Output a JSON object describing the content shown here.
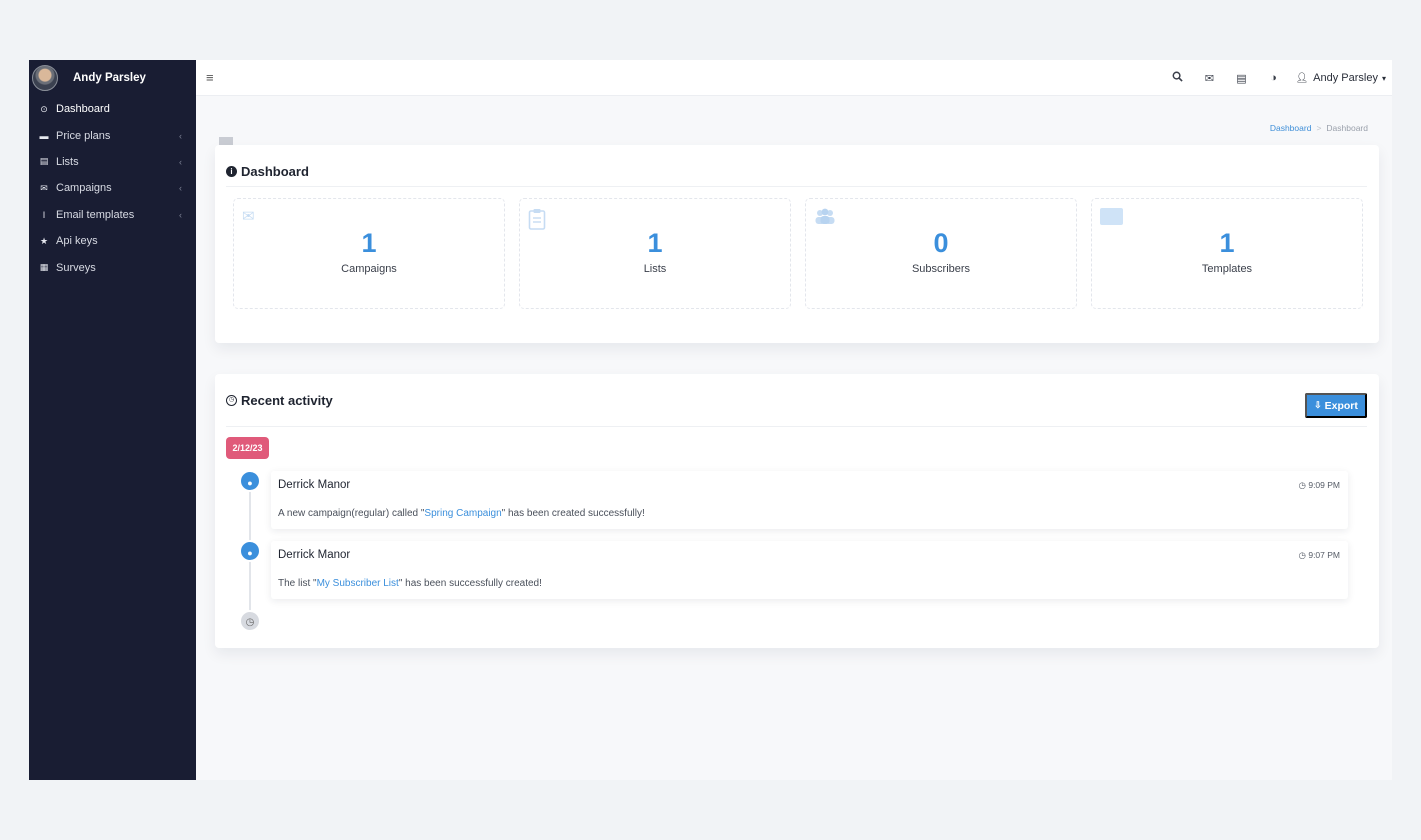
{
  "sidebar": {
    "user_name": "Andy Parsley",
    "items": [
      {
        "label": "Dashboard",
        "icon": "dashboard-icon",
        "glyph": "⊙",
        "caret": ""
      },
      {
        "label": "Price plans",
        "icon": "credit-card-icon",
        "glyph": "▬",
        "caret": "‹"
      },
      {
        "label": "Lists",
        "icon": "list-icon",
        "glyph": "▤",
        "caret": "‹"
      },
      {
        "label": "Campaigns",
        "icon": "envelope-icon",
        "glyph": "✉",
        "caret": "‹"
      },
      {
        "label": "Email templates",
        "icon": "text-cursor-icon",
        "glyph": "I",
        "caret": "‹"
      },
      {
        "label": "Api keys",
        "icon": "star-icon",
        "glyph": "★",
        "caret": ""
      },
      {
        "label": "Surveys",
        "icon": "survey-icon",
        "glyph": "▦",
        "caret": ""
      }
    ]
  },
  "topbar": {
    "user_name": "Andy Parsley",
    "icons": [
      "search-icon",
      "envelope-icon",
      "news-icon",
      "contrast-icon"
    ]
  },
  "breadcrumb": {
    "link": "Dashboard",
    "current": "Dashboard"
  },
  "dashboard": {
    "title": "Dashboard",
    "stats": [
      {
        "value": "1",
        "label": "Campaigns",
        "icon": "envelope-icon"
      },
      {
        "value": "1",
        "label": "Lists",
        "icon": "clipboard-icon"
      },
      {
        "value": "0",
        "label": "Subscribers",
        "icon": "users-icon"
      },
      {
        "value": "1",
        "label": "Templates",
        "icon": "folder-icon"
      }
    ]
  },
  "activity": {
    "title": "Recent activity",
    "export_label": "Export",
    "date": "2/12/23",
    "entries": [
      {
        "name": "Derrick Manor",
        "time": "9:09 PM",
        "pre": "A new campaign(regular) called \"",
        "highlight": "Spring Campaign",
        "post": "\" has been created successfully!"
      },
      {
        "name": "Derrick Manor",
        "time": "9:07 PM",
        "pre": "The list \"",
        "highlight": "My Subscriber List",
        "post": "\" has been successfully created!"
      }
    ]
  },
  "colors": {
    "sidebar": "#191d33",
    "accent": "#3b8fdc",
    "date_badge": "#e05a7a"
  }
}
